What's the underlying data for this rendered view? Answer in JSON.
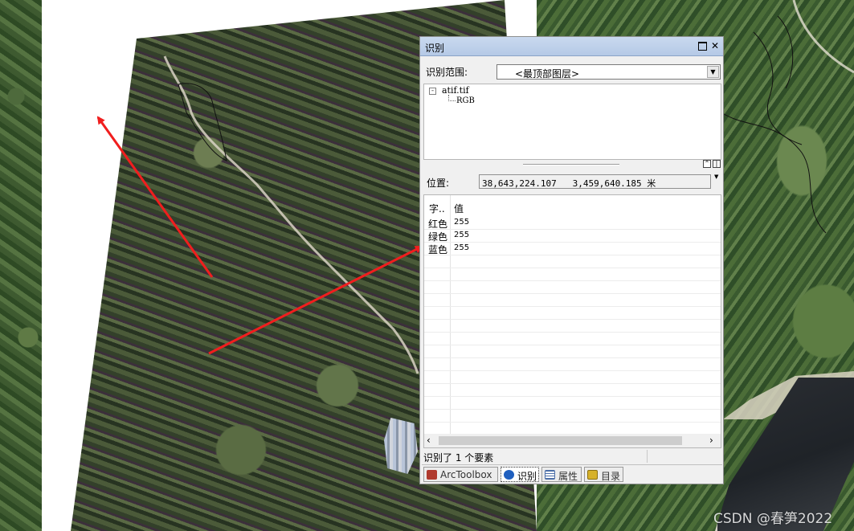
{
  "window": {
    "title": "识别",
    "close_glyph": "✕"
  },
  "identify_from": {
    "label": "识别范围:",
    "selected": "<最顶部图层>"
  },
  "tree": {
    "layer": "atif.tif",
    "child": "RGB",
    "collapse_glyph": "-"
  },
  "location": {
    "label": "位置:",
    "value": "38,643,224.107   3,459,640.185 米"
  },
  "fields": {
    "header_field": "字..",
    "header_value": "值",
    "rows": [
      {
        "name": "红色",
        "value": "255"
      },
      {
        "name": "绿色",
        "value": "255"
      },
      {
        "name": "蓝色",
        "value": "255"
      }
    ]
  },
  "status": {
    "text": "识别了 1 个要素"
  },
  "tabs": [
    {
      "label": "ArcToolbox",
      "icon": "toolbox-icon"
    },
    {
      "label": "识别",
      "icon": "identify-icon"
    },
    {
      "label": "属性",
      "icon": "attributes-icon"
    },
    {
      "label": "目录",
      "icon": "catalog-icon"
    }
  ],
  "watermark": "CSDN @春笋2022",
  "colors": {
    "arrow": "#f01e1e",
    "title_bar": "#c2d4ec"
  }
}
